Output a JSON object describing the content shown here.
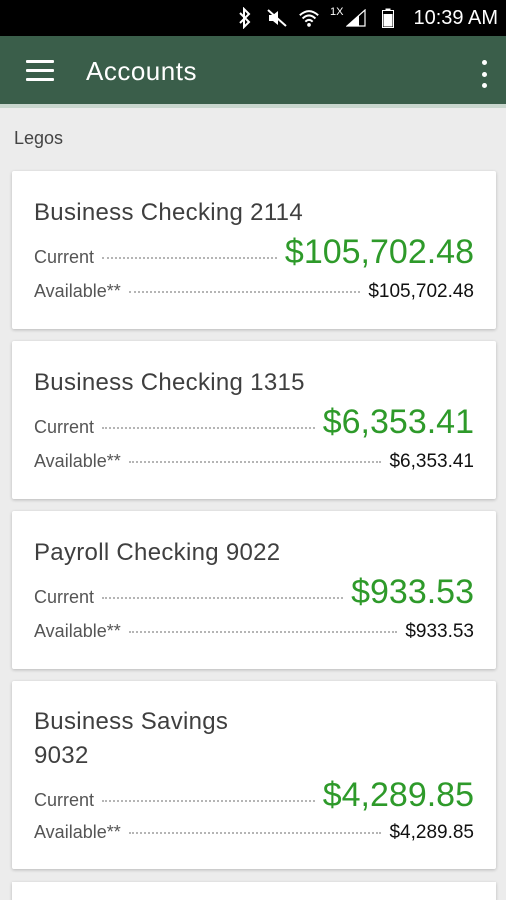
{
  "status_bar": {
    "icons": [
      "bluetooth-icon",
      "mute-icon",
      "wifi-icon",
      "signal-icon",
      "battery-icon"
    ],
    "network_label": "1X",
    "time": "10:39 AM"
  },
  "app_bar": {
    "title": "Accounts",
    "menu_icon": "hamburger-menu-icon",
    "overflow_icon": "more-vert-icon",
    "background": "#3a5e4a"
  },
  "group": {
    "label": "Legos"
  },
  "colors": {
    "accent_amount": "#2e9a2a"
  },
  "accounts": [
    {
      "name": "Business Checking 2114",
      "current_label": "Current",
      "current": "$105,702.48",
      "available_label": "Available**",
      "available": "$105,702.48"
    },
    {
      "name": "Business Checking 1315",
      "current_label": "Current",
      "current": "$6,353.41",
      "available_label": "Available**",
      "available": "$6,353.41"
    },
    {
      "name": "Payroll Checking 9022",
      "current_label": "Current",
      "current": "$933.53",
      "available_label": "Available**",
      "available": "$933.53"
    },
    {
      "name_line1": "Business Savings",
      "name_line2": "9032",
      "current_label": "Current",
      "current": "$4,289.85",
      "available_label": "Available**",
      "available": "$4,289.85"
    }
  ]
}
